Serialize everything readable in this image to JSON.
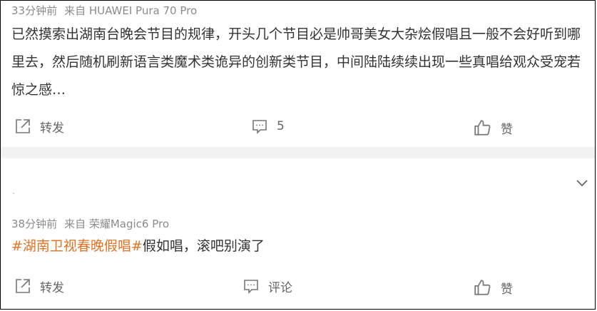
{
  "posts": [
    {
      "time": "33分钟前",
      "source": "来自 HUAWEI Pura 70 Pro",
      "hashtag": "",
      "text": "已然摸索出湖南台晚会节目的规律，开头几个节目必是帅哥美女大杂烩假唱且一般不会好听到哪里去，然后随机刷新语言类魔术类诡异的创新类节目，中间陆陆续续出现一些真唱给观众受宠若惊之感…",
      "actions": {
        "repost": "转发",
        "comment": "5",
        "like": "赞"
      }
    },
    {
      "time": "38分钟前",
      "source": "来自 荣耀Magic6 Pro",
      "hashtag": "#湖南卫视春晚假唱#",
      "text": "假如唱，滚吧别演了",
      "actions": {
        "repost": "转发",
        "comment": "评论",
        "like": "赞"
      }
    }
  ],
  "icons": {
    "repost": "share-icon",
    "comment": "comment-icon",
    "like": "thumbs-up-icon",
    "expand": "chevron-down-icon"
  },
  "colors": {
    "hashtag": "#e37223",
    "meta_text": "#8b8b8b",
    "body_text": "#333333",
    "divider": "#f2f2f2"
  }
}
